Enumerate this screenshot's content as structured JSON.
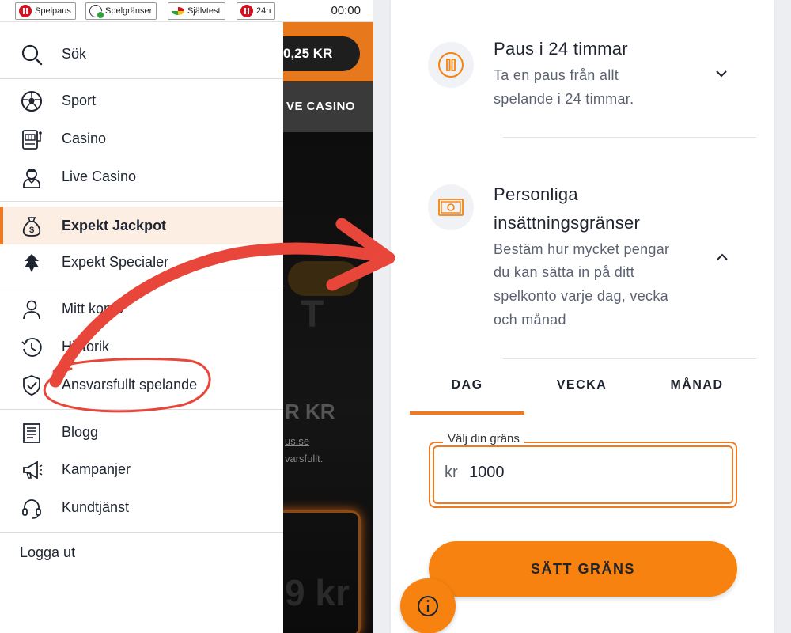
{
  "topbar": {
    "buttons": [
      {
        "label": "Spelpaus",
        "icon": "pause-icon"
      },
      {
        "label": "Spelgränser",
        "icon": "limit-icon"
      },
      {
        "label": "Självtest",
        "icon": "gauge-icon"
      },
      {
        "label": "24h",
        "icon": "pause-icon"
      }
    ],
    "time": "00:00"
  },
  "background": {
    "balance": "0,25 KR",
    "nav": "VE CASINO",
    "kr": "R KR",
    "link": "us.se",
    "small": "varsfullt.",
    "card": "9 kr",
    "big": "T"
  },
  "menu": {
    "search": "Sök",
    "items": [
      {
        "label": "Sport",
        "icon": "football-icon"
      },
      {
        "label": "Casino",
        "icon": "slot-machine-icon"
      },
      {
        "label": "Live Casino",
        "icon": "dealer-icon"
      },
      {
        "label": "Expekt Jackpot",
        "icon": "money-bag-icon",
        "active": true
      },
      {
        "label": "Expekt Specialer",
        "icon": "special-icon"
      },
      {
        "label": "Mitt konto",
        "icon": "user-icon"
      },
      {
        "label": "Historik",
        "icon": "history-icon"
      },
      {
        "label": "Ansvarsfullt spelande",
        "icon": "shield-check-icon"
      },
      {
        "label": "Blogg",
        "icon": "newspaper-icon"
      },
      {
        "label": "Kampanjer",
        "icon": "megaphone-icon"
      },
      {
        "label": "Kundtjänst",
        "icon": "headset-icon"
      }
    ],
    "logout": "Logga ut"
  },
  "panel": {
    "pause": {
      "title": "Paus i 24 timmar",
      "desc_line1": "Ta en paus från allt",
      "desc_line2": "spelande i 24 timmar."
    },
    "deposit": {
      "title_line1": "Personliga",
      "title_line2": "insättningsgränser",
      "desc_line1": "Bestäm hur mycket pengar",
      "desc_line2": "du kan sätta in på ditt",
      "desc_line3": "spelkonto varje dag, vecka",
      "desc_line4": "och månad"
    },
    "tabs": [
      "DAG",
      "VECKA",
      "MÅNAD"
    ],
    "active_tab": "DAG",
    "limit_label": "Välj din gräns",
    "limit_prefix": "kr",
    "limit_value": "1000",
    "submit": "SÄTT GRÄNS"
  },
  "colors": {
    "accent": "#f7820f",
    "annotation": "#e8463a",
    "text": "#1e2430"
  }
}
